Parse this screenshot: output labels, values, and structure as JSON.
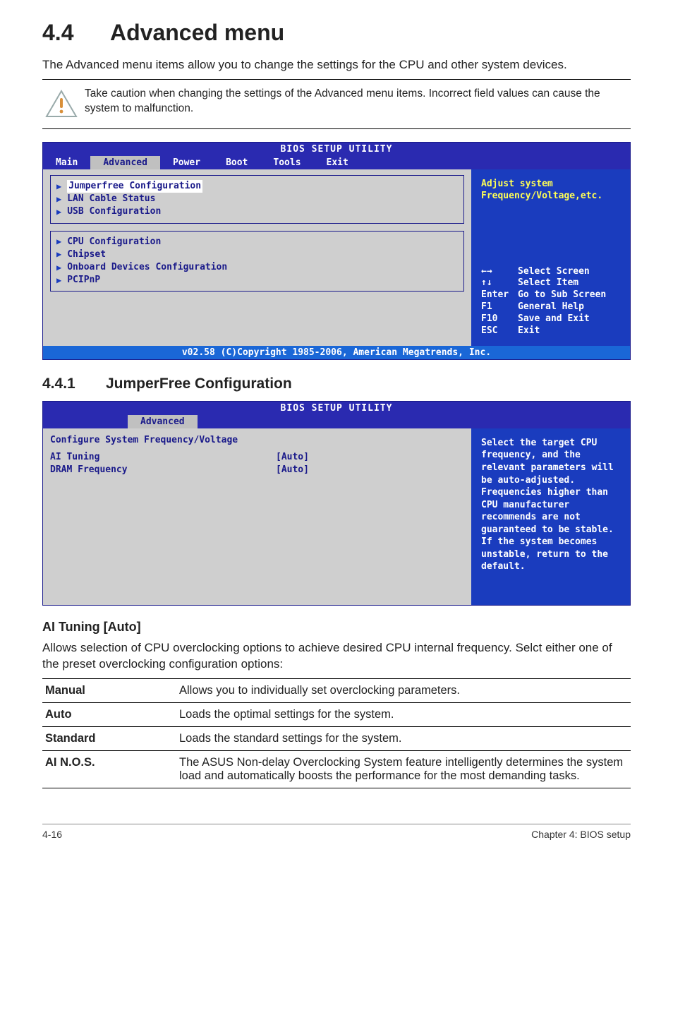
{
  "section": {
    "number": "4.4",
    "title": "Advanced menu"
  },
  "intro": "The Advanced menu items allow you to change the settings for the CPU and other system devices.",
  "caution": "Take caution when changing the settings of the Advanced menu items. Incorrect field values can cause the system to malfunction.",
  "bios1": {
    "title": "BIOS SETUP UTILITY",
    "tabs": [
      "Main",
      "Advanced",
      "Power",
      "Boot",
      "Tools",
      "Exit"
    ],
    "selected_tab": "Advanced",
    "group1": [
      "Jumperfree Configuration",
      "LAN Cable Status",
      "USB Configuration"
    ],
    "group2": [
      "CPU Configuration",
      "Chipset",
      "Onboard Devices Configuration",
      "PCIPnP"
    ],
    "hint": "Adjust system Frequency/Voltage,etc.",
    "keys": [
      {
        "k": "←→",
        "d": "Select Screen"
      },
      {
        "k": "↑↓",
        "d": "Select Item"
      },
      {
        "k": "Enter",
        "d": "Go to Sub Screen"
      },
      {
        "k": "F1",
        "d": "General Help"
      },
      {
        "k": "F10",
        "d": "Save and Exit"
      },
      {
        "k": "ESC",
        "d": "Exit"
      }
    ],
    "footer": "v02.58 (C)Copyright 1985-2006, American Megatrends, Inc."
  },
  "subsection": {
    "number": "4.4.1",
    "title": "JumperFree Configuration"
  },
  "bios2": {
    "title": "BIOS SETUP UTILITY",
    "tabs_single": "Advanced",
    "heading": "Configure System Frequency/Voltage",
    "items": [
      {
        "k": "AI Tuning",
        "v": "[Auto]"
      },
      {
        "k": "DRAM Frequency",
        "v": "[Auto]"
      }
    ],
    "hint": "Select the target CPU frequency, and the relevant parameters will be auto-adjusted. Frequencies higher than CPU manufacturer recommends are not guaranteed to be stable. If the system becomes unstable, return to the default."
  },
  "param": {
    "name": "AI Tuning [Auto]"
  },
  "param_desc": "Allows selection of CPU overclocking options to achieve desired CPU internal frequency. Selct either one of the preset overclocking configuration options:",
  "defs": [
    {
      "term": "Manual",
      "desc": "Allows you to individually set overclocking parameters."
    },
    {
      "term": "Auto",
      "desc": "Loads the optimal settings for the system."
    },
    {
      "term": "Standard",
      "desc": "Loads the standard settings for the system."
    },
    {
      "term": "AI N.O.S.",
      "desc": "The ASUS Non-delay Overclocking System feature intelligently determines the system load and automatically boosts the performance for the most demanding tasks."
    }
  ],
  "footer": {
    "left": "4-16",
    "right": "Chapter 4: BIOS setup"
  }
}
